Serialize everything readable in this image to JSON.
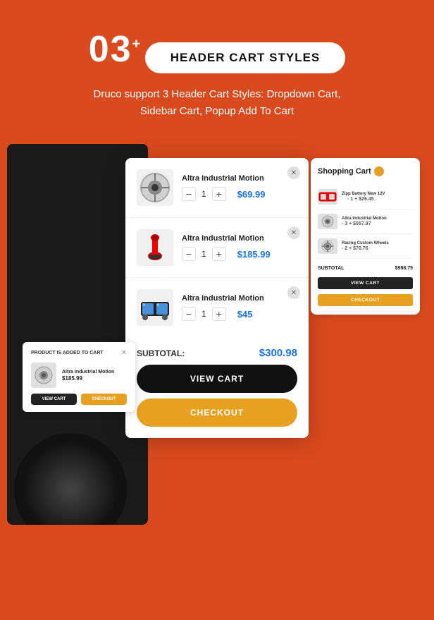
{
  "header": {
    "step": "03",
    "step_sup": "+",
    "title": "HEADER CART STYLES",
    "subtitle": "Druco support 3 Header Cart Styles: Dropdown Cart, Sidebar Cart, Popup Add To Cart"
  },
  "main_cart": {
    "items": [
      {
        "name": "Altra Industrial Motion",
        "qty": 1,
        "price": "$69.99",
        "img_label": "brake-disc-icon"
      },
      {
        "name": "Altra Industrial Motion",
        "qty": 1,
        "price": "$185.99",
        "img_label": "shock-absorber-icon"
      },
      {
        "name": "Altra Industrial Motion",
        "qty": 1,
        "price": "$45",
        "img_label": "headlight-icon"
      }
    ],
    "subtotal_label": "SUBTOTAL:",
    "subtotal_value": "$300.98",
    "view_cart_label": "VIEW CART",
    "checkout_label": "CHECKOUT"
  },
  "popup": {
    "header_text": "PRODUCT IS ADDED TO CART",
    "product_name": "Altra Industrial Motion",
    "product_price": "$185.99",
    "view_cart_label": "VIEW CART",
    "checkout_label": "CHECKOUT"
  },
  "sidebar_cart": {
    "title": "Shopping Cart",
    "items": [
      {
        "name": "Zipp Battery New 12V",
        "qty": "- 1 +",
        "price": "$26.45",
        "img_label": "battery-icon"
      },
      {
        "name": "Altra Industrial Motion",
        "qty": "- 3 +",
        "price": "$557.97",
        "img_label": "brake-disc-icon-2"
      },
      {
        "name": "Racing Custom Wheels",
        "qty": "- 2 +",
        "price": "$70.76",
        "img_label": "wheel-icon"
      }
    ],
    "subtotal_label": "SUBTOTAL",
    "subtotal_value": "$998.75",
    "view_cart_label": "VIEW CART",
    "checkout_label": "CHECKOUT"
  },
  "colors": {
    "bg": "#d94a1e",
    "accent": "#e8a020",
    "price_blue": "#1a73e8",
    "dark": "#111111",
    "white": "#ffffff"
  }
}
